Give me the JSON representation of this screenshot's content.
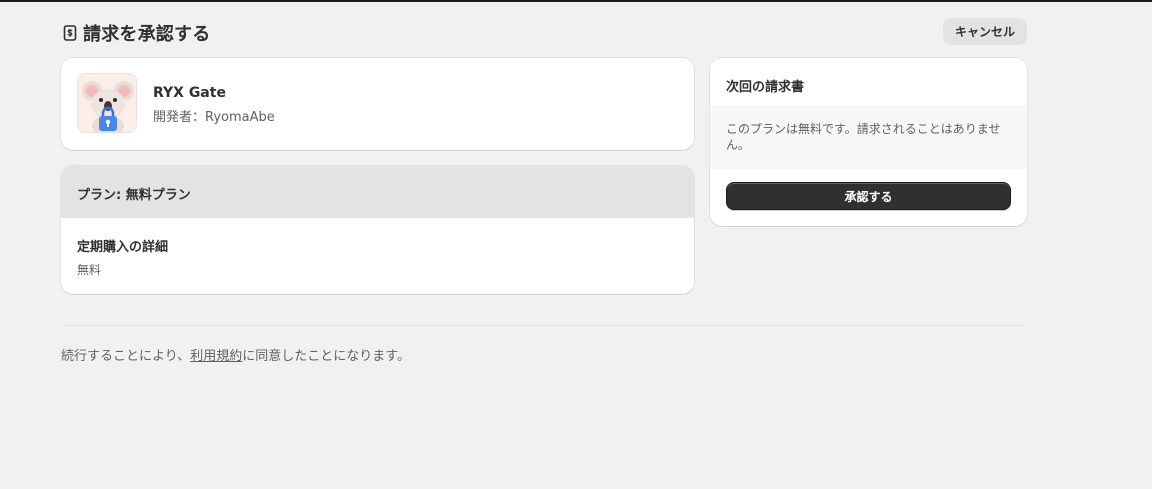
{
  "header": {
    "title": "請求を承認する",
    "icon": "receipt-icon",
    "cancel_label": "キャンセル"
  },
  "app": {
    "name": "RYX Gate",
    "developer": "開発者：RyomaAbe",
    "logo": "koala-lock-logo"
  },
  "plan": {
    "title": "プラン: 無料プラン",
    "subscription_label": "定期購入の詳細",
    "subscription_value": "無料"
  },
  "invoice": {
    "title": "次回の請求書",
    "note": "このプランは無料です。請求されることはありません。",
    "approve_label": "承認する"
  },
  "footer": {
    "prefix": "続行することにより、",
    "terms_link": "利用規約",
    "suffix": "に同意したことになります。"
  },
  "colors": {
    "background": "#f1f1f1",
    "primary_button": "#303030",
    "secondary_button": "#e3e3e3",
    "text": "#303030",
    "muted_text": "#616161"
  }
}
